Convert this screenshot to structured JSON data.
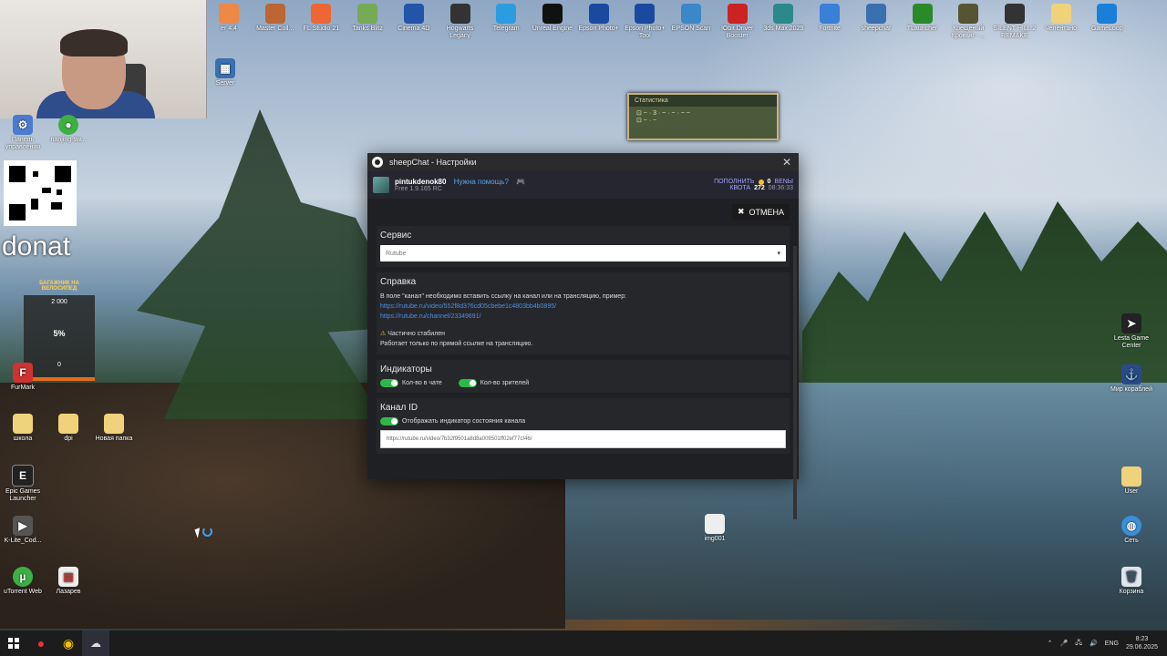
{
  "desktop_top_icons": [
    {
      "label": "er 4.4"
    },
    {
      "label": "Master Coll..."
    },
    {
      "label": "FL Studio 21"
    },
    {
      "label": "Tanks Blitz"
    },
    {
      "label": "Cinema 4D"
    },
    {
      "label": "Hogwarts Legacy"
    },
    {
      "label": "Telegram"
    },
    {
      "label": "Unreal Engine"
    },
    {
      "label": "Epson Photo+"
    },
    {
      "label": "Epson Photo+ Tool"
    },
    {
      "label": "EPSON Scan"
    },
    {
      "label": "IObit Driver Booster"
    },
    {
      "label": "3ds Max 2025"
    },
    {
      "label": "Fortnite"
    },
    {
      "label": "sheepchat"
    },
    {
      "label": "TLauncher"
    },
    {
      "label": "Крещеный Кровью - ..."
    },
    {
      "label": "SILENT HILL 2 REMAKE"
    },
    {
      "label": "Челентано"
    },
    {
      "label": "GameLoop"
    }
  ],
  "desktop_left_icons": [
    {
      "label": "Server"
    },
    {
      "label": "Панель управления"
    },
    {
      "label": "nanjing-sw..."
    },
    {
      "label": "FurMark"
    },
    {
      "label": "школа"
    },
    {
      "label": "dpi"
    },
    {
      "label": "Новая папка"
    },
    {
      "label": "Epic Games Launcher"
    },
    {
      "label": "K-Lite_Cod..."
    },
    {
      "label": "uTorrent Web"
    },
    {
      "label": "Лазарев"
    }
  ],
  "desktop_right_icons": [
    {
      "label": "Lesta Game Center"
    },
    {
      "label": "Мир кораблей"
    },
    {
      "label": "User"
    },
    {
      "label": "Сеть"
    },
    {
      "label": "Корзина"
    }
  ],
  "desktop_file": {
    "label": "img001"
  },
  "overlay": {
    "donat": "donat",
    "widget_title": "БАГАЖНИК НА ВЕЛОСИПЕД",
    "widget_top": "2 000",
    "widget_percent": "5%",
    "widget_bottom": "0",
    "stat_title": "Статистика"
  },
  "window": {
    "title": "sheepChat - Настройки",
    "user": {
      "name": "pintukdenok80",
      "help": "Нужна помощь?",
      "plan": "Free 1.9.165 RC",
      "topup": "ПОПОЛНИТЬ",
      "balance": "0",
      "currency": "ВЕNЫ",
      "quota_label": "КВОТА",
      "quota_value": "272",
      "quota_time": "08:36:33"
    },
    "cancel_label": "ОТМЕНА",
    "service": {
      "title": "Сервис",
      "selected": "Rutube"
    },
    "reference": {
      "title": "Справка",
      "text": "В поле \"канал\" необходимо вставить ссылку на канал или на трансляцию, пример:",
      "link1": "https://rutube.ru/video/552f8d376cd05cbebe1c4803bb4b0895/",
      "link2": "https://rutube.ru/channel/23349691/",
      "warning": "Частично стабилен",
      "note": "Работает только по прямой ссылке на трансляцию."
    },
    "indicators": {
      "title": "Индикаторы",
      "chat_count": "Кол-во в чате",
      "viewers_count": "Кол-во зрителей"
    },
    "channel": {
      "title": "Канал ID",
      "toggle_label": "Отображать индикатор состояния канала",
      "url": "https://rutube.ru/video/7b32f9501a8d8a009501ff02ef77cf46/"
    }
  },
  "taskbar": {
    "lang": "ENG",
    "time": "8:23",
    "date": "29.06.2025"
  }
}
